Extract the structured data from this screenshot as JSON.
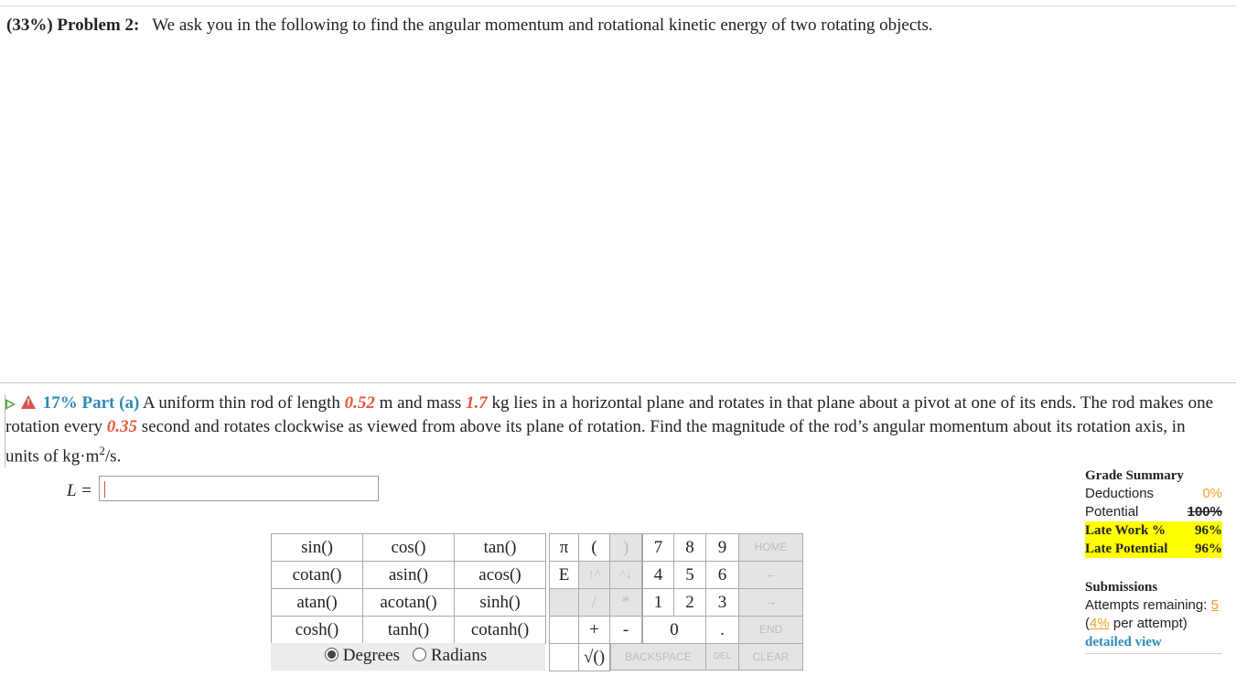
{
  "problem": {
    "label": "(33%) Problem 2:",
    "text": "We ask you in the following to find the angular momentum and rotational kinetic energy of two rotating objects."
  },
  "part_a": {
    "label": "17% Part (a)",
    "text_1": "A uniform thin rod of length",
    "length": "0.52",
    "text_2": "m and mass",
    "mass": "1.7",
    "text_3": "kg lies in a horizontal plane and rotates in that plane about a pivot at one of its ends. The rod makes one rotation every",
    "period": "0.35",
    "text_4": "second and rotates clockwise as viewed from above its plane of rotation. Find the magnitude of the rod’s angular momentum about its rotation axis, in units of kg·m",
    "exp": "2",
    "text_5": "/s."
  },
  "answer": {
    "label": "L =",
    "value": ""
  },
  "calculator": {
    "functions": [
      [
        "sin()",
        "cos()",
        "tan()"
      ],
      [
        "cotan()",
        "asin()",
        "acos()"
      ],
      [
        "atan()",
        "acotan()",
        "sinh()"
      ],
      [
        "cosh()",
        "tanh()",
        "cotanh()"
      ]
    ],
    "pi": "π",
    "e": "E",
    "lparen": "(",
    "rparen": ")",
    "up_exp": "↑^",
    "down_exp": "^↓",
    "divide": "/",
    "multiply": "*",
    "plus": "+",
    "minus": "-",
    "sqrt": "√()",
    "digits_row1": [
      "7",
      "8",
      "9"
    ],
    "digits_row2": [
      "4",
      "5",
      "6"
    ],
    "digits_row3": [
      "1",
      "2",
      "3"
    ],
    "zero": "0",
    "dot": ".",
    "home": "HOME",
    "left_arrow": "←",
    "right_arrow": "→",
    "end": "END",
    "backspace": "BACKSPACE",
    "del": "DEL",
    "clear": "CLEAR",
    "degrees": "Degrees",
    "radians": "Radians",
    "selected_mode": "Degrees"
  },
  "grade_summary": {
    "title": "Grade Summary",
    "deductions_label": "Deductions",
    "deductions_value": "0%",
    "potential_label": "Potential",
    "potential_value": "100%",
    "late_work_label": "Late Work %",
    "late_work_value": "96%",
    "late_potential_label": "Late Potential",
    "late_potential_value": "96%"
  },
  "submissions": {
    "title": "Submissions",
    "attempts_label": "Attempts remaining:",
    "attempts_value": "5",
    "per_attempt_value": "4%",
    "per_attempt_suffix": "per attempt)",
    "detailed_view": "detailed view"
  },
  "colors": {
    "accent": "#2e8bb8",
    "given": "#e8553a",
    "highlight": "#ffff00",
    "warning": "#d9534f",
    "expand": "#5aa84a"
  }
}
